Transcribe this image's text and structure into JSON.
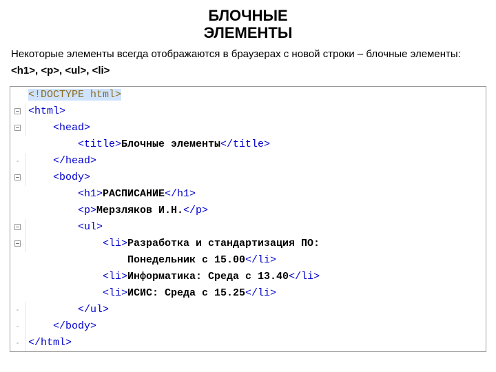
{
  "title_line1": "БЛОЧНЫЕ",
  "title_line2": "ЭЛЕМЕНТЫ",
  "intro_prefix": "Некоторые элементы всегда отображаются в браузерах с новой строки – блочные элементы: ",
  "intro_tags": "<h1>, <p>,  <ul>, <li>",
  "code": {
    "doctype": "<!DOCTYPE html>",
    "html_open": "<html>",
    "head_open": "<head>",
    "title_open": "<title>",
    "title_text": "Блочные элементы",
    "title_close": "</title>",
    "head_close": "</head>",
    "body_open": "<body>",
    "h1_open": "<h1>",
    "h1_text": "РАСПИСАНИЕ",
    "h1_close": "</h1>",
    "p_open": "<p>",
    "p_text": "Мерзляков И.Н.",
    "p_close": "</p>",
    "ul_open": "<ul>",
    "li_open": "<li>",
    "li1_text_a": "Разработка и стандартизация ПО:",
    "li1_text_b": "Понедельник с 15.00",
    "li_close": "</li>",
    "li2_text": "Информатика: Среда с 13.40",
    "li3_text": "ИСИС: Среда с 15.25",
    "ul_close": "</ul>",
    "body_close": "</body>",
    "html_close": "</html>"
  }
}
